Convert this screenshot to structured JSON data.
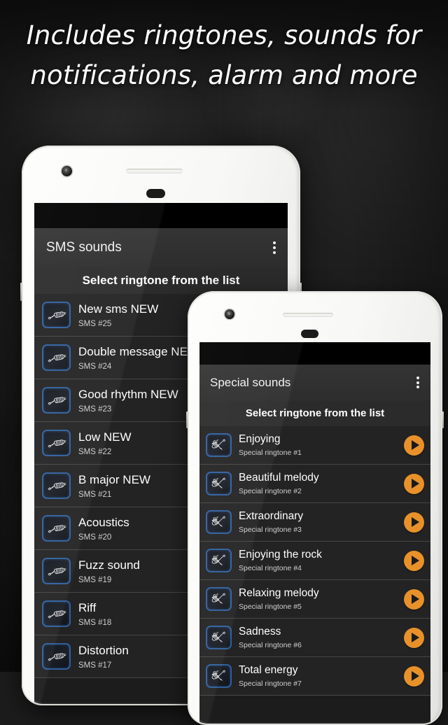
{
  "headline": {
    "line1": "Includes ringtones, sounds for",
    "line2": "notifications, alarm and more"
  },
  "colors": {
    "accent_orange": "#e8912b",
    "icon_border_blue": "#2f5f9e",
    "appbar": "#2d2d2d",
    "list_bg": "#232323",
    "background": "#1e1e1e",
    "phone_body": "#fdfdfb"
  },
  "phone_left": {
    "app": {
      "title": "SMS sounds",
      "overflow_menu": "more-options",
      "subheader": "Select ringtone from the list",
      "items": [
        {
          "title": "New sms NEW",
          "subtitle": "SMS #25",
          "icon": "guitar-icon"
        },
        {
          "title": "Double message NEW",
          "subtitle": "SMS #24",
          "icon": "guitar-icon"
        },
        {
          "title": "Good rhythm NEW",
          "subtitle": "SMS #23",
          "icon": "guitar-icon"
        },
        {
          "title": "Low NEW",
          "subtitle": "SMS #22",
          "icon": "guitar-icon"
        },
        {
          "title": "B major NEW",
          "subtitle": "SMS #21",
          "icon": "guitar-icon"
        },
        {
          "title": "Acoustics",
          "subtitle": "SMS #20",
          "icon": "guitar-icon"
        },
        {
          "title": "Fuzz sound",
          "subtitle": "SMS #19",
          "icon": "guitar-icon"
        },
        {
          "title": "Riff",
          "subtitle": "SMS #18",
          "icon": "guitar-icon"
        },
        {
          "title": "Distortion",
          "subtitle": "SMS #17",
          "icon": "guitar-icon"
        }
      ]
    }
  },
  "phone_right": {
    "app": {
      "title": "Special sounds",
      "overflow_menu": "more-options",
      "subheader": "Select ringtone from the list",
      "play_button_label": "play",
      "items": [
        {
          "title": "Enjoying",
          "subtitle": "Special ringtone #1",
          "icon": "guitar-notes-icon"
        },
        {
          "title": "Beautiful melody",
          "subtitle": "Special ringtone #2",
          "icon": "guitar-notes-icon"
        },
        {
          "title": "Extraordinary",
          "subtitle": "Special ringtone #3",
          "icon": "guitar-notes-icon"
        },
        {
          "title": "Enjoying the rock",
          "subtitle": "Special ringtone #4",
          "icon": "guitar-notes-icon"
        },
        {
          "title": "Relaxing melody",
          "subtitle": "Special ringtone #5",
          "icon": "guitar-notes-icon"
        },
        {
          "title": "Sadness",
          "subtitle": "Special ringtone #6",
          "icon": "guitar-notes-icon"
        },
        {
          "title": "Total energy",
          "subtitle": "Special ringtone #7",
          "icon": "guitar-notes-icon"
        }
      ]
    }
  }
}
